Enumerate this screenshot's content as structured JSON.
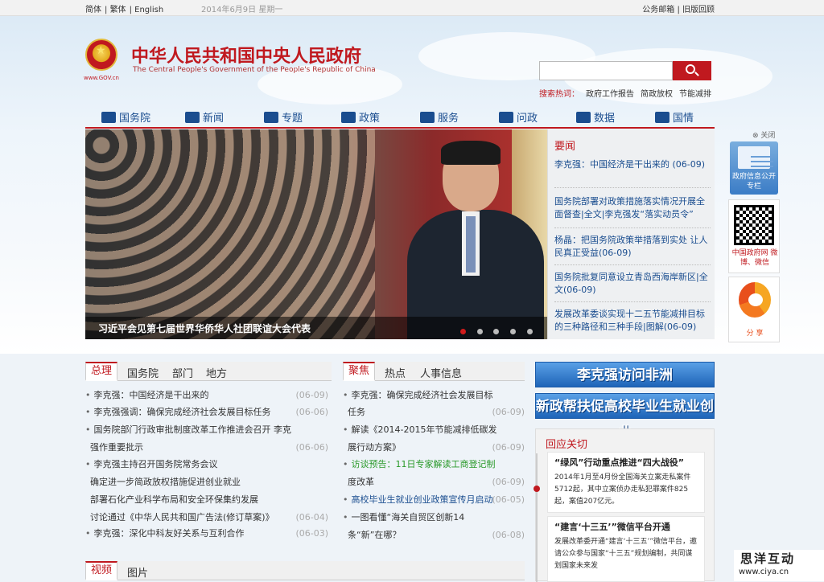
{
  "topbar": {
    "lang_simplified": "简体",
    "lang_traditional": "繁体",
    "lang_english": "English",
    "date": "2014年6月9日 星期一",
    "mail": "公务邮箱",
    "old_version": "旧版回顾"
  },
  "header": {
    "title_cn": "中华人民共和国中央人民政府",
    "title_en": "The Central People's Government of the People's Republic of China",
    "site": "www.GOV.cn"
  },
  "search": {
    "placeholder": "",
    "hot_label": "搜索热词：",
    "hot_words": [
      "政府工作报告",
      "简政放权",
      "节能减排"
    ]
  },
  "nav": {
    "items": [
      "国务院",
      "新闻",
      "专题",
      "政策",
      "服务",
      "问政",
      "数据",
      "国情"
    ]
  },
  "slide": {
    "caption": "习近平会见第七届世界华侨华人社团联谊大会代表",
    "active_dot": 1,
    "dot_count": 5
  },
  "headlines": {
    "title": "要闻",
    "items": [
      {
        "text": "李克强：中国经济是干出来的",
        "date": "(06-09)"
      },
      {
        "text": "国务院部署对政策措施落实情况开展全面督查|全文|李克强发“落实动员令”",
        "date": ""
      },
      {
        "text": "杨晶：把国务院政策举措落到实处 让人民真正受益",
        "date": "(06-09)"
      },
      {
        "text": "国务院批复同意设立青岛西海岸新区|全文",
        "date": "(06-09)"
      },
      {
        "text": "发展改革委谈实现十二五节能减排目标的三种路径和三种手段|图解",
        "date": "(06-09)"
      }
    ]
  },
  "widgets": {
    "close": "关闭",
    "gov_info": "政府信息公开专栏",
    "qr_label": "中国政府网 微博、微信",
    "share": "分 享"
  },
  "left_tabs": {
    "tabs": [
      "总理",
      "国务院",
      "部门",
      "地方"
    ],
    "items": [
      {
        "text": "李克强：中国经济是干出来的",
        "date": "(06-09)"
      },
      {
        "text": "李克强强调：确保完成经济社会发展目标任务",
        "date": "(06-06)"
      },
      {
        "text": "国务院部门行政审批制度改革工作推进会召开 李克",
        "date": ""
      },
      {
        "text": "强作重要批示",
        "date": "(06-06)"
      },
      {
        "text": "李克强主持召开国务院常务会议",
        "date": ""
      },
      {
        "text": "确定进一步简政放权措施促进创业就业",
        "date": ""
      },
      {
        "text": "部署石化产业科学布局和安全环保集约发展",
        "date": ""
      },
      {
        "text": "讨论通过《中华人民共和国广告法(修订草案)》",
        "date": "(06-04)"
      },
      {
        "text": "李克强：深化中科友好关系与互利合作",
        "date": "(06-03)"
      }
    ]
  },
  "mid_tabs": {
    "tabs": [
      "聚焦",
      "热点",
      "人事信息"
    ],
    "items": [
      {
        "text": "李克强：确保完成经济社会发展目标",
        "date": ""
      },
      {
        "text": "任务",
        "date": "(06-09)"
      },
      {
        "text": "解读《2014-2015年节能减排低碳发",
        "date": ""
      },
      {
        "text": "展行动方案》",
        "date": "(06-09)"
      },
      {
        "text": "访谈预告：11日专家解读工商登记制",
        "date": "",
        "prefix": "访谈预告："
      },
      {
        "text": "度改革",
        "date": "(06-09)"
      },
      {
        "text": "高校毕业生就业创业政策宣传月启动",
        "date": "(06-05)"
      },
      {
        "text": "一图看懂“海关自贸区创新14",
        "date": ""
      },
      {
        "text": "条“新”在哪？",
        "date": "(06-08)"
      }
    ]
  },
  "bottom_tabs": {
    "tabs": [
      "视频",
      "图片"
    ]
  },
  "banners": {
    "b1": "李克强访问非洲",
    "b2": "新政帮扶促高校毕业生就业创业"
  },
  "focus": {
    "title": "回应关切",
    "cards": [
      {
        "title": "“绿风”行动重点推进“四大战役”",
        "body": "2014年1月至4月份全国海关立案走私案件5712起，其中立案侦办走私犯罪案件825起，案值207亿元。"
      },
      {
        "title": "“建言‘十三五’”微信平台开通",
        "body": "发展改革委开通“建言‘十三五’”微信平台，邀请公众参与国家“十三五”规划编制，共同谋划国家未来发"
      }
    ]
  },
  "watermark": {
    "cn": "思洋互动",
    "url": "www.ciya.cn"
  }
}
